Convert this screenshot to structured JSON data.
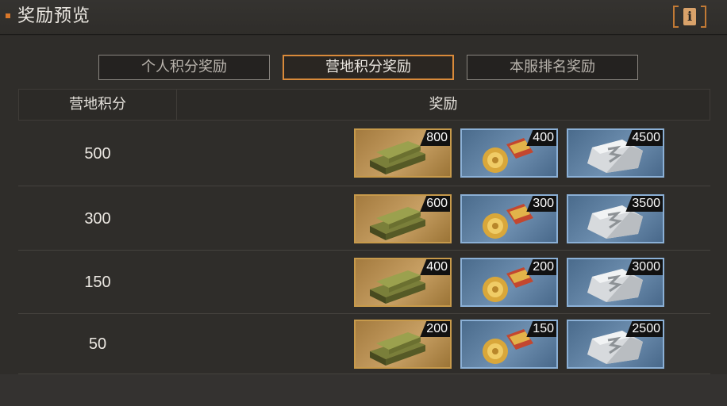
{
  "title": "奖励预览",
  "info_button_glyph": "i",
  "tabs": [
    {
      "label": "个人积分奖励",
      "active": false
    },
    {
      "label": "营地积分奖励",
      "active": true
    },
    {
      "label": "本服排名奖励",
      "active": false
    }
  ],
  "table": {
    "headers": [
      "营地积分",
      "奖励"
    ],
    "rows": [
      {
        "score": "500",
        "rewards": [
          {
            "icon": "gold-bars-icon",
            "qty": "800"
          },
          {
            "icon": "medal-icon",
            "qty": "400"
          },
          {
            "icon": "silver-ore-icon",
            "qty": "4500"
          }
        ]
      },
      {
        "score": "300",
        "rewards": [
          {
            "icon": "gold-bars-icon",
            "qty": "600"
          },
          {
            "icon": "medal-icon",
            "qty": "300"
          },
          {
            "icon": "silver-ore-icon",
            "qty": "3500"
          }
        ]
      },
      {
        "score": "150",
        "rewards": [
          {
            "icon": "gold-bars-icon",
            "qty": "400"
          },
          {
            "icon": "medal-icon",
            "qty": "200"
          },
          {
            "icon": "silver-ore-icon",
            "qty": "3000"
          }
        ]
      },
      {
        "score": "50",
        "rewards": [
          {
            "icon": "gold-bars-icon",
            "qty": "200"
          },
          {
            "icon": "medal-icon",
            "qty": "150"
          },
          {
            "icon": "silver-ore-icon",
            "qty": "2500"
          }
        ]
      }
    ]
  },
  "colors": {
    "accent": "#d98a3a",
    "gold_slot": "#c8a064",
    "blue_slot": "#6e8fb0"
  }
}
